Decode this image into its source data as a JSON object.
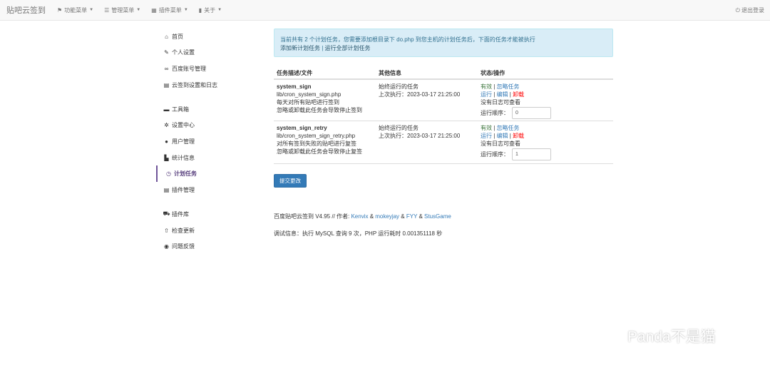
{
  "navbar": {
    "brand": "贴吧云签到",
    "menus": [
      {
        "label": "功能菜单",
        "icon": "tags-icon"
      },
      {
        "label": "管理菜单",
        "icon": "list-icon"
      },
      {
        "label": "插件菜单",
        "icon": "grid-icon"
      },
      {
        "label": "关于",
        "icon": "book-icon"
      }
    ],
    "logout": "退出登录"
  },
  "sidebar": {
    "items": [
      {
        "label": "首页",
        "icon": "home-icon"
      },
      {
        "label": "个人设置",
        "icon": "wrench-icon"
      },
      {
        "label": "百度账号管理",
        "icon": "link-icon"
      },
      {
        "label": "云签到设置和日志",
        "icon": "list-icon"
      },
      {
        "label": "工具箱",
        "icon": "briefcase-icon"
      },
      {
        "label": "设置中心",
        "icon": "gear-icon"
      },
      {
        "label": "用户管理",
        "icon": "user-icon"
      },
      {
        "label": "统计信息",
        "icon": "stats-icon"
      },
      {
        "label": "计划任务",
        "icon": "clock-icon"
      },
      {
        "label": "插件管理",
        "icon": "list-icon"
      },
      {
        "label": "插件库",
        "icon": "cart-icon"
      },
      {
        "label": "检查更新",
        "icon": "upload-icon"
      },
      {
        "label": "问题反馈",
        "icon": "globe-icon"
      }
    ]
  },
  "alert": {
    "line1": "当前共有 2 个计划任务，您需要添加根目录下 do.php 到您主机的计划任务后，下面的任务才能被执行",
    "add_link": "添加新计划任务",
    "separator": "|",
    "run_all_link": "运行全部计划任务"
  },
  "table": {
    "headers": [
      "任务描述/文件",
      "其他信息",
      "状态/操作"
    ],
    "rows": [
      {
        "name": "system_sign",
        "file": "lib/cron_system_sign.php",
        "desc1": "每天对所有贴吧进行签到",
        "desc2": "忽略或卸载此任务会导致停止签到",
        "info1": "始终运行的任务",
        "info2": "上次执行：2023-03-17 21:25:00",
        "status": "有效",
        "ignore": "忽略任务",
        "run": "运行",
        "edit": "编辑",
        "uninstall": "卸载",
        "log": "没有日志可查看",
        "order_label": "运行顺序：",
        "order_value": "0"
      },
      {
        "name": "system_sign_retry",
        "file": "lib/cron_system_sign_retry.php",
        "desc1": "对所有签到失败的贴吧进行复签",
        "desc2": "忽略或卸载此任务会导致停止复签",
        "info1": "始终运行的任务",
        "info2": "上次执行：2023-03-17 21:25:00",
        "status": "有效",
        "ignore": "忽略任务",
        "run": "运行",
        "edit": "编辑",
        "uninstall": "卸载",
        "log": "没有日志可查看",
        "order_label": "运行顺序：",
        "order_value": "1"
      }
    ]
  },
  "submit_label": "提交更改",
  "footer": {
    "prefix": "百度贴吧云签到 V4.95 // 作者: ",
    "author1": "Kenvix",
    "amp": " & ",
    "author2": "mokeyjay",
    "author3": "FYY",
    "author4": "StusGame",
    "debug": "调试信息：执行 MySQL 查询 9 次，PHP 运行耗时 0.001351118 秒"
  },
  "watermark": "Panda不是猫",
  "colors": {
    "link": "#337ab7",
    "active_border": "#6f5499",
    "alert_bg": "#d9edf7",
    "status_green": "#3c763d",
    "uninstall_red": "#ff0000",
    "button": "#337ab7"
  }
}
